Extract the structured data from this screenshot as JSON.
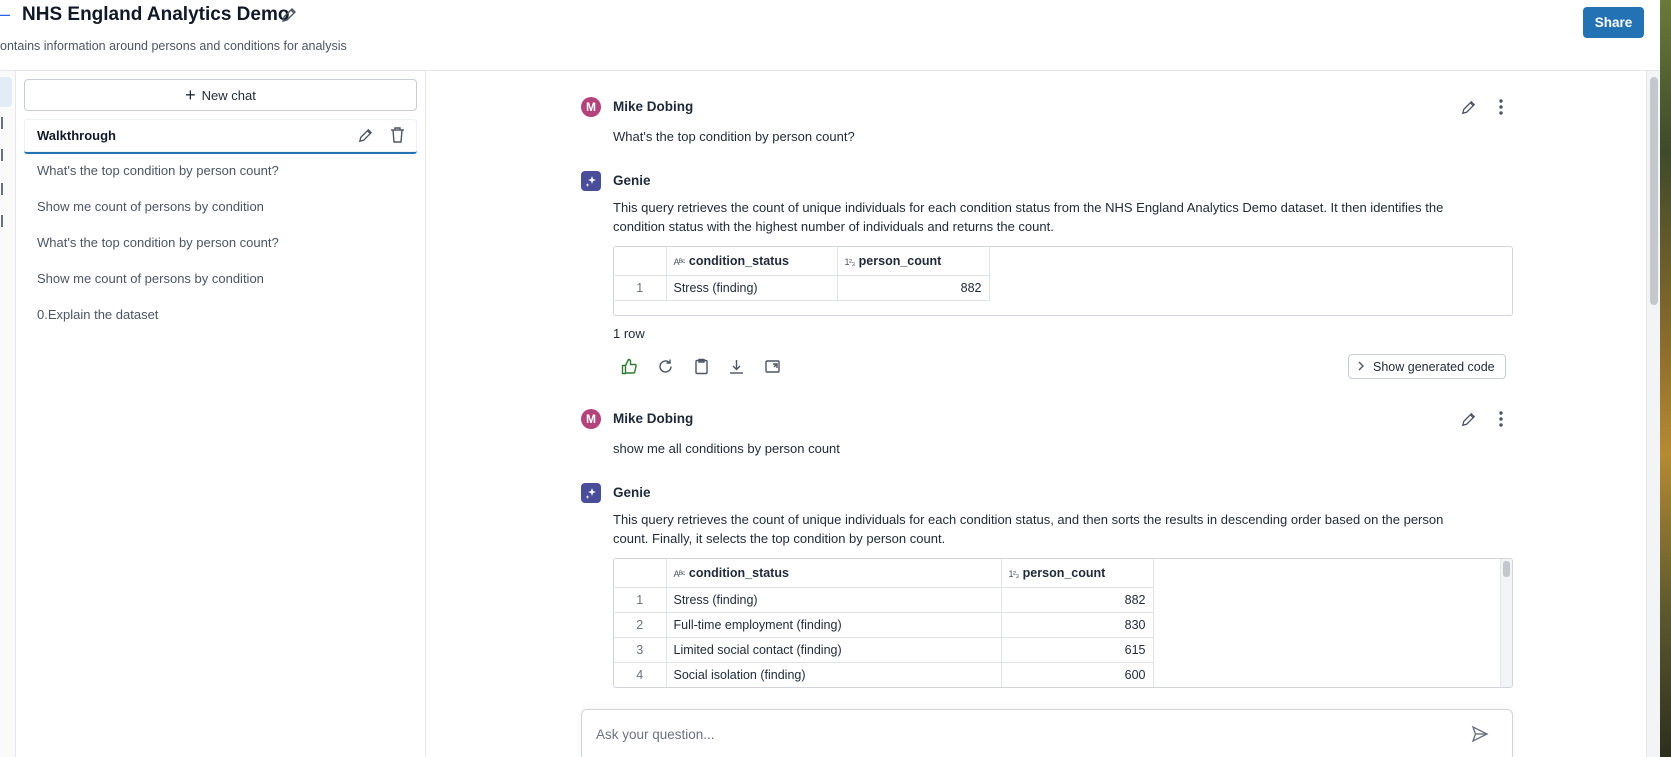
{
  "header": {
    "title": "NHS England Analytics Demo",
    "subtitle": "ontains information around persons and conditions for analysis",
    "share_label": "Share"
  },
  "sidebar": {
    "new_chat_label": "New chat",
    "active_chat": "Walkthrough",
    "history": [
      "What's the top condition by person count?",
      "Show me count of persons by condition",
      "What's the top condition by person count?",
      "Show me count of persons by condition",
      "0.Explain the dataset"
    ]
  },
  "conversation": {
    "user_name": "Mike Dobing",
    "user_initial": "M",
    "genie_name": "Genie",
    "q1": "What's the top condition by person count?",
    "a1_line1": "This query retrieves the count of unique individuals for each condition status from the NHS England Analytics Demo dataset. It then identifies the",
    "a1_line2": "condition status with the highest number of individuals and returns the count.",
    "table1": {
      "col_text_tag": "Aᴮᶜ",
      "col_num_tag": "1²₃",
      "columns": [
        "condition_status",
        "person_count"
      ],
      "rows": [
        [
          "1",
          "Stress (finding)",
          "882"
        ]
      ]
    },
    "row_count": "1 row",
    "show_code_label": "Show generated code",
    "q2": "show me all conditions by person count",
    "a2_line1": "This query retrieves the count of unique individuals for each condition status, and then sorts the results in descending order based on the person",
    "a2_line2": "count. Finally, it selects the top condition by person count.",
    "table2": {
      "columns": [
        "condition_status",
        "person_count"
      ],
      "rows": [
        [
          "1",
          "Stress (finding)",
          "882"
        ],
        [
          "2",
          "Full-time employment (finding)",
          "830"
        ],
        [
          "3",
          "Limited social contact (finding)",
          "615"
        ],
        [
          "4",
          "Social isolation (finding)",
          "600"
        ]
      ]
    }
  },
  "composer": {
    "placeholder": "Ask your question..."
  },
  "colors": {
    "primary": "#2272b4",
    "avatar": "#b3437a",
    "genie": "#4a4e9a",
    "thumbs_up": "#2e7d32"
  }
}
